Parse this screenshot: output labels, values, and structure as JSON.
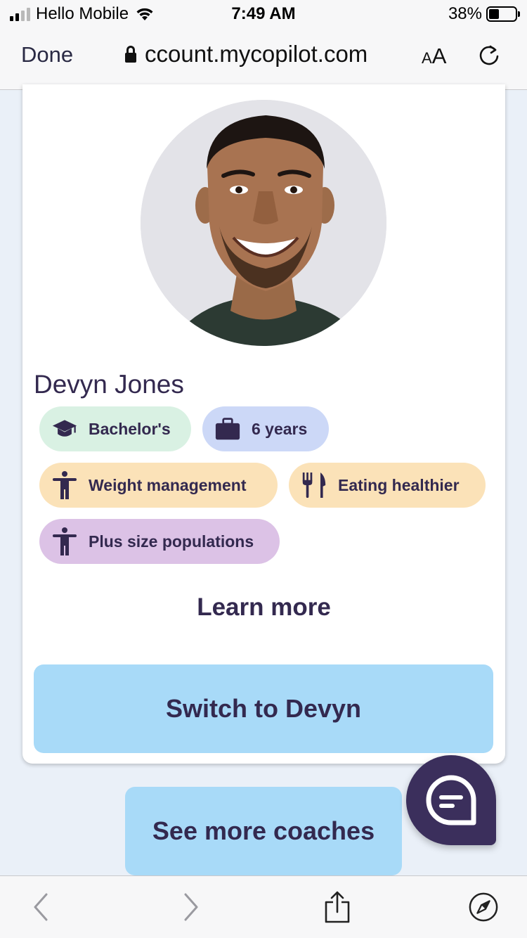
{
  "status_bar": {
    "carrier": "Hello Mobile",
    "time": "7:49 AM",
    "battery": "38%",
    "battery_level": 0.38
  },
  "browser": {
    "done_label": "Done",
    "url": "ccount.mycopilot.com",
    "text_size_small": "A",
    "text_size_large": "A"
  },
  "coach": {
    "name": "Devyn Jones",
    "tags": [
      {
        "label": "Bachelor's",
        "icon": "graduation-cap-icon",
        "color": "#d9f1e3"
      },
      {
        "label": "6 years",
        "icon": "briefcase-icon",
        "color": "#ccd8f7"
      },
      {
        "label": "Weight management",
        "icon": "person-icon",
        "color": "#fbe2b8"
      },
      {
        "label": "Eating healthier",
        "icon": "utensils-icon",
        "color": "#fbe2b8"
      },
      {
        "label": "Plus size populations",
        "icon": "person-icon",
        "color": "#dcc2e6"
      }
    ],
    "learn_more": "Learn more",
    "switch_button": "Switch to Devyn"
  },
  "see_more_button": "See more coaches",
  "colors": {
    "brand_dark": "#33294f",
    "button_blue": "#a8daf8",
    "page_bg": "#eaf0f8",
    "fab": "#3b2f5c"
  },
  "toolbar": {
    "icons": [
      "back-icon",
      "forward-icon",
      "share-icon",
      "compass-icon"
    ]
  }
}
